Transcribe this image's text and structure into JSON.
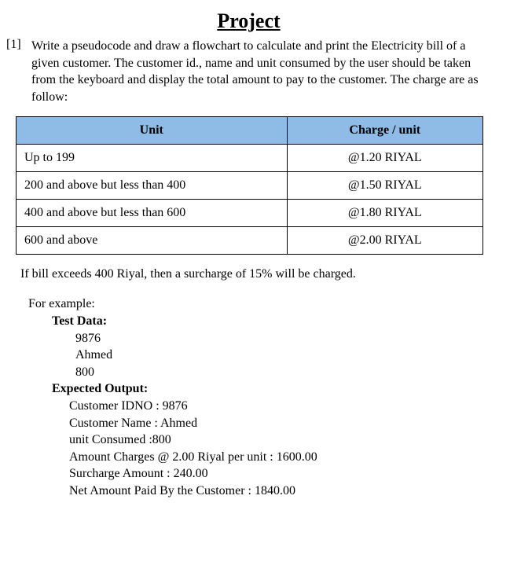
{
  "title": "Project",
  "question": {
    "number": "[1]",
    "text": "Write a pseudocode and draw a flowchart to calculate and print the Electricity bill of a given customer. The customer id., name and unit consumed by the user should be taken from the keyboard and display the total amount to pay to the customer. The charge are as follow:"
  },
  "table": {
    "headers": {
      "unit": "Unit",
      "charge": "Charge / unit"
    },
    "rows": [
      {
        "unit": "Up to 199",
        "charge": "@1.20 RIYAL"
      },
      {
        "unit": "200 and above but less than 400",
        "charge": "@1.50 RIYAL"
      },
      {
        "unit": "400 and above but less than 600",
        "charge": "@1.80 RIYAL"
      },
      {
        "unit": "600 and above",
        "charge": "@2.00 RIYAL"
      }
    ]
  },
  "surcharge_note": "If bill exceeds 400 Riyal, then a surcharge of 15% will be charged.",
  "example": {
    "for_example": "For example:",
    "test_data_label": "Test Data:",
    "test_data": {
      "id": "9876",
      "name": "Ahmed",
      "units": "800"
    },
    "expected_label": "Expected Output:",
    "expected": {
      "idno": "Customer IDNO : 9876",
      "name": "Customer Name : Ahmed",
      "units": "unit Consumed :800",
      "amount": "Amount Charges @ 2.00 Riyal per unit : 1600.00",
      "surcharge": "Surcharge Amount : 240.00",
      "net": "Net Amount Paid By the Customer : 1840.00"
    }
  }
}
